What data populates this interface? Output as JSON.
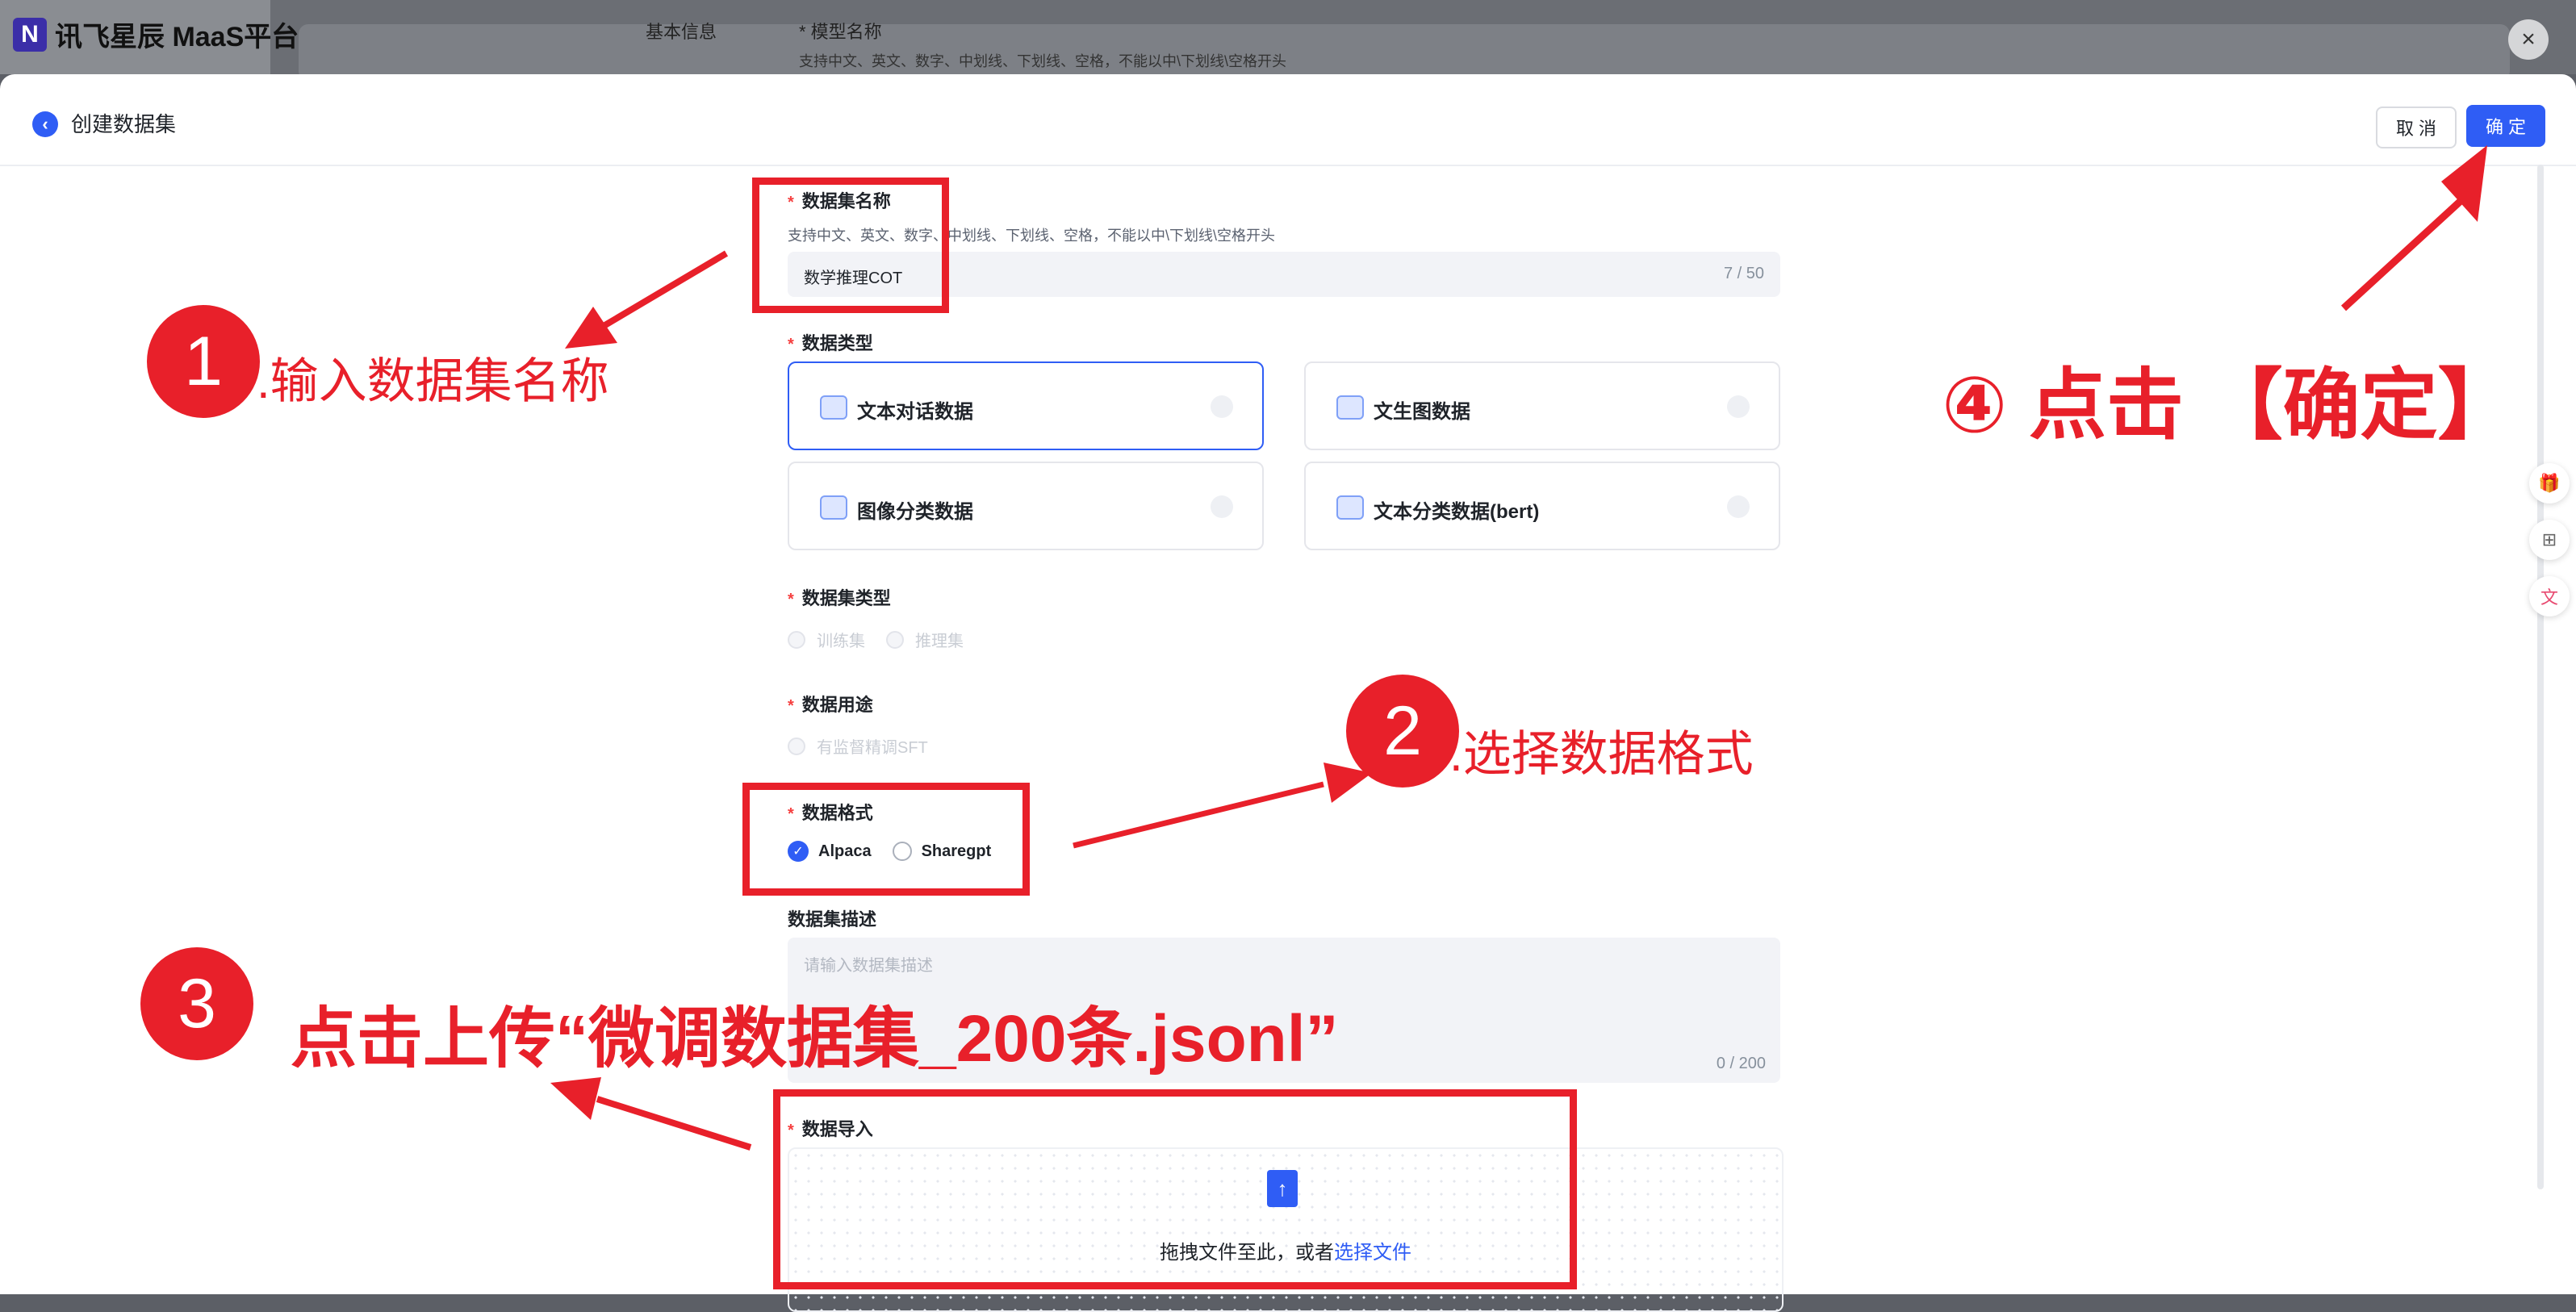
{
  "background": {
    "logo_mark": "N",
    "logo_text": "讯飞星辰 MaaS平台",
    "section": "基本信息",
    "field_label": "* 模型名称",
    "field_hint": "支持中文、英文、数字、中划线、下划线、空格，不能以中\\下划线\\空格开头",
    "close": "×"
  },
  "header": {
    "back_icon": "arrow-left-icon",
    "title": "创建数据集",
    "cancel_label": "取 消",
    "confirm_label": "确 定"
  },
  "form": {
    "required_mark": "*",
    "name": {
      "label": "数据集名称",
      "hint": "支持中文、英文、数字、中划线、下划线、空格，不能以中\\下划线\\空格开头",
      "value": "数学推理COT",
      "count": "7 / 50"
    },
    "data_type": {
      "label": "数据类型",
      "options": [
        {
          "label": "文本对话数据",
          "selected": true
        },
        {
          "label": "文生图数据",
          "selected": false
        },
        {
          "label": "图像分类数据",
          "selected": false
        },
        {
          "label": "文本分类数据(bert)",
          "selected": false
        }
      ]
    },
    "set_type": {
      "label": "数据集类型",
      "options": [
        "训练集",
        "推理集"
      ]
    },
    "usage": {
      "label": "数据用途",
      "options": [
        "有监督精调SFT"
      ]
    },
    "format": {
      "label": "数据格式",
      "options": [
        {
          "label": "Alpaca",
          "checked": true
        },
        {
          "label": "Sharegpt",
          "checked": false
        }
      ]
    },
    "description": {
      "label": "数据集描述",
      "placeholder": "请输入数据集描述",
      "count": "0 / 200"
    },
    "import": {
      "label": "数据导入",
      "text": "拖拽文件至此，或者",
      "link": "选择文件"
    }
  },
  "side_buttons": [
    "gift-icon",
    "apps-icon",
    "translate-icon"
  ],
  "annotations": {
    "step1_num": "1",
    "step1_text": ".输入数据集名称",
    "step2_num": "2",
    "step2_text": ".选择数据格式",
    "step3_num": "3",
    "step3_text": "点击上传“微调数据集_200条.jsonl”",
    "step4_text": "④ 点击 【确定】"
  },
  "colors": {
    "accent": "#2f5df5",
    "annotation_red": "#e8202a"
  }
}
